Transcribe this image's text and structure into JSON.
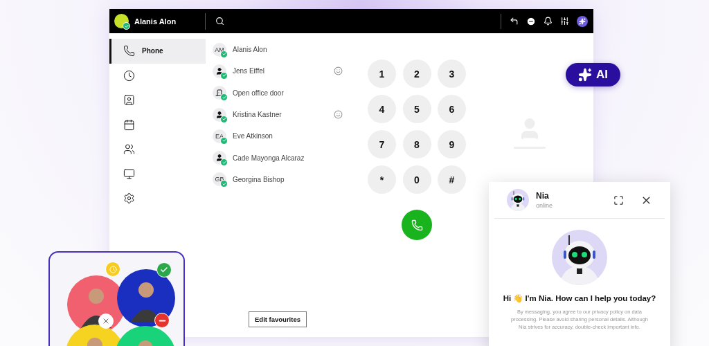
{
  "user": {
    "name": "Alanis Alon",
    "online": true
  },
  "nav": [
    {
      "kind": "phone",
      "label": "Phone",
      "selected": true
    },
    {
      "kind": "history",
      "selected": false
    },
    {
      "kind": "contacts",
      "selected": false
    },
    {
      "kind": "calendar",
      "selected": false
    },
    {
      "kind": "conference",
      "selected": false
    },
    {
      "kind": "desk",
      "selected": false
    },
    {
      "kind": "settings",
      "selected": false
    }
  ],
  "favourites": [
    {
      "kind": "initials",
      "initials": "AM",
      "name": "Alanis Alon",
      "online": true,
      "emoji": false
    },
    {
      "kind": "person",
      "name": "Jens Eiffel",
      "online": true,
      "emoji": true
    },
    {
      "kind": "door",
      "name": "Open office door",
      "online": true,
      "emoji": false
    },
    {
      "kind": "person",
      "name": "Kristina Kastner",
      "online": true,
      "emoji": true
    },
    {
      "kind": "initials",
      "initials": "EA",
      "name": "Eve Atkinson",
      "online": true,
      "emoji": false
    },
    {
      "kind": "person",
      "name": "Cade Mayonga Alcaraz",
      "online": true,
      "emoji": false
    },
    {
      "kind": "initials",
      "initials": "GB",
      "name": "Georgina Bishop",
      "online": true,
      "emoji": false
    }
  ],
  "dialpad": [
    "1",
    "2",
    "3",
    "4",
    "5",
    "6",
    "7",
    "8",
    "9",
    "*",
    "0",
    "#"
  ],
  "edit_button": "Edit favourites",
  "ai_badge": "AI",
  "favourite_card": {
    "people": [
      {
        "kind": "away"
      },
      {
        "kind": "available"
      },
      {
        "kind": "offline"
      },
      {
        "kind": "busy"
      }
    ]
  },
  "chat": {
    "name": "Nia",
    "status": "online",
    "greeting": "Hi 👋 I'm Nia. How can I help you today?",
    "disclaimer": "By messaging, you agree to our privacy policy on data processing. Please avoid sharing personal details. Although Nia strives for accuracy, double-check important info."
  }
}
